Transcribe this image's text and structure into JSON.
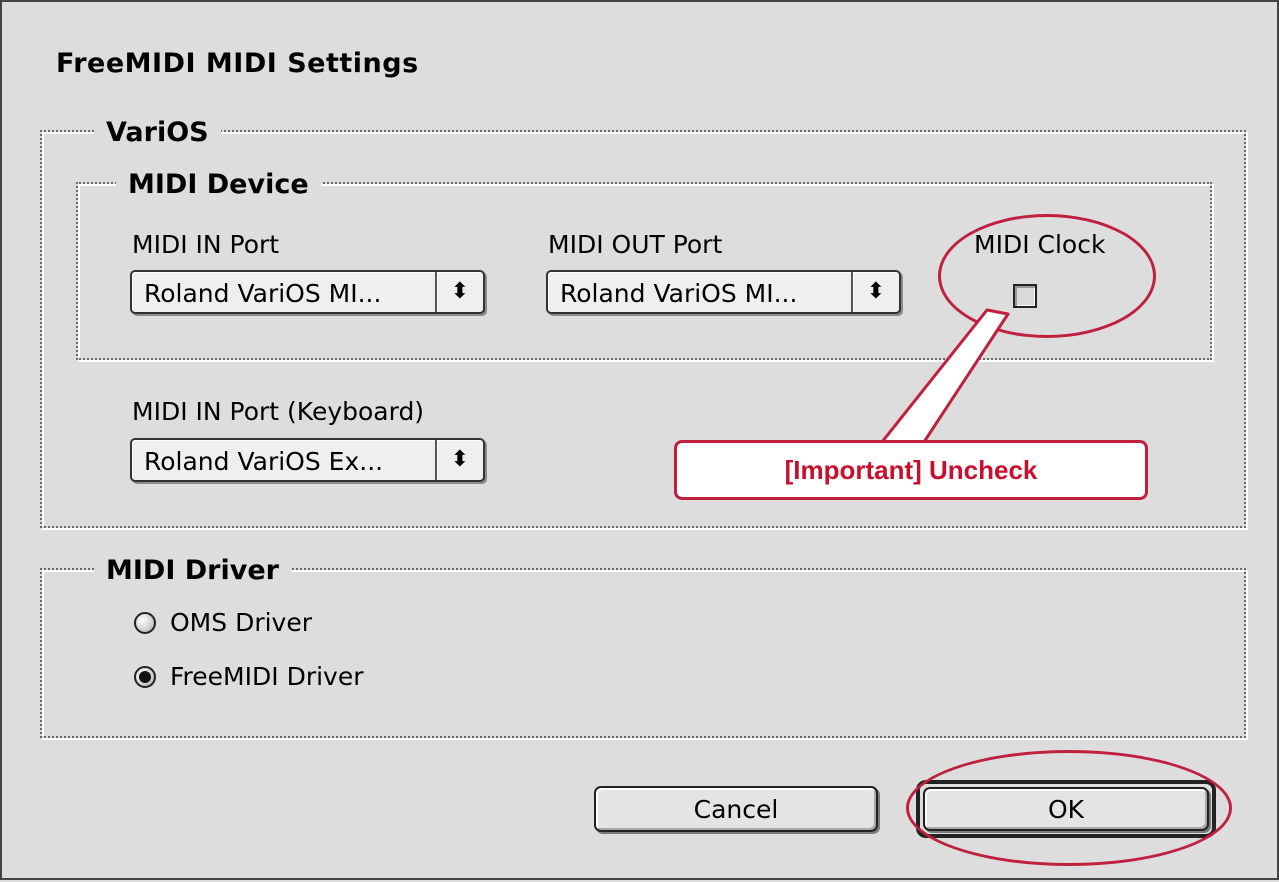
{
  "dialog": {
    "title": "FreeMIDI MIDI Settings"
  },
  "varios_group": {
    "legend": "VariOS",
    "midi_device": {
      "legend": "MIDI Device",
      "midi_in": {
        "label": "MIDI IN Port",
        "value": "Roland VariOS MI..."
      },
      "midi_out": {
        "label": "MIDI OUT Port",
        "value": "Roland VariOS MI..."
      },
      "midi_clock": {
        "label": "MIDI Clock",
        "checked": false
      }
    },
    "midi_in_keyboard": {
      "label": "MIDI IN Port (Keyboard)",
      "value": "Roland VariOS Ex..."
    }
  },
  "midi_driver_group": {
    "legend": "MIDI Driver",
    "options": [
      {
        "label": "OMS Driver",
        "selected": false
      },
      {
        "label": "FreeMIDI Driver",
        "selected": true
      }
    ]
  },
  "buttons": {
    "cancel": "Cancel",
    "ok": "OK"
  },
  "annotation": {
    "callout_text": "[Important] Uncheck",
    "color": "#c8102e"
  }
}
